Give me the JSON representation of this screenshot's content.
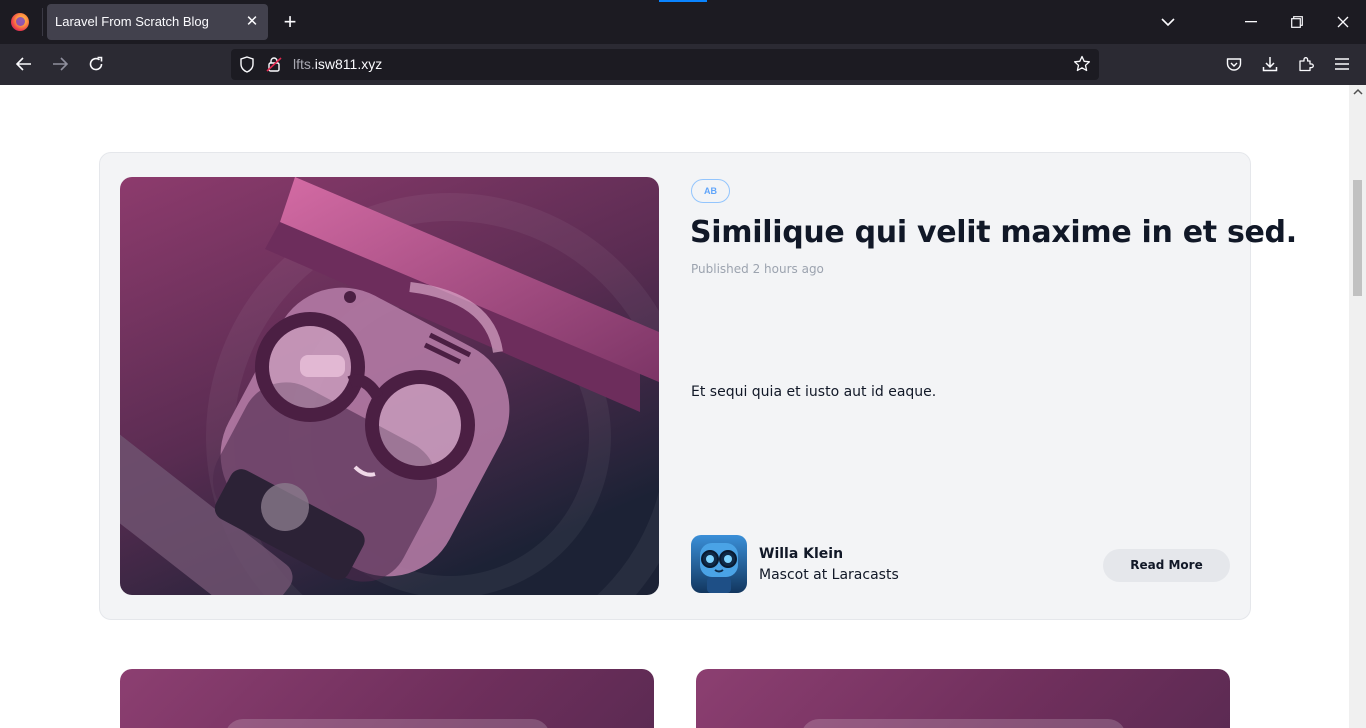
{
  "browser": {
    "tab_title": "Laravel From Scratch Blog",
    "tab_close": "✕",
    "new_tab": "+",
    "url_host_prefix": "lfts.",
    "url_domain": "isw811.xyz"
  },
  "post": {
    "category": "AB",
    "title": "Similique qui velit maxime in et sed.",
    "published": "Published 2 hours ago",
    "excerpt": "Et sequi quia et iusto aut id eaque.",
    "author_name": "Willa Klein",
    "author_role": "Mascot at Laracasts",
    "read_more": "Read More"
  },
  "colors": {
    "chrome_dark": "#1c1b22",
    "chrome_toolbar": "#2b2a33",
    "card_bg": "#f3f4f6",
    "badge_blue": "#60a5fa",
    "thumb_purple": "#8c3f71"
  }
}
